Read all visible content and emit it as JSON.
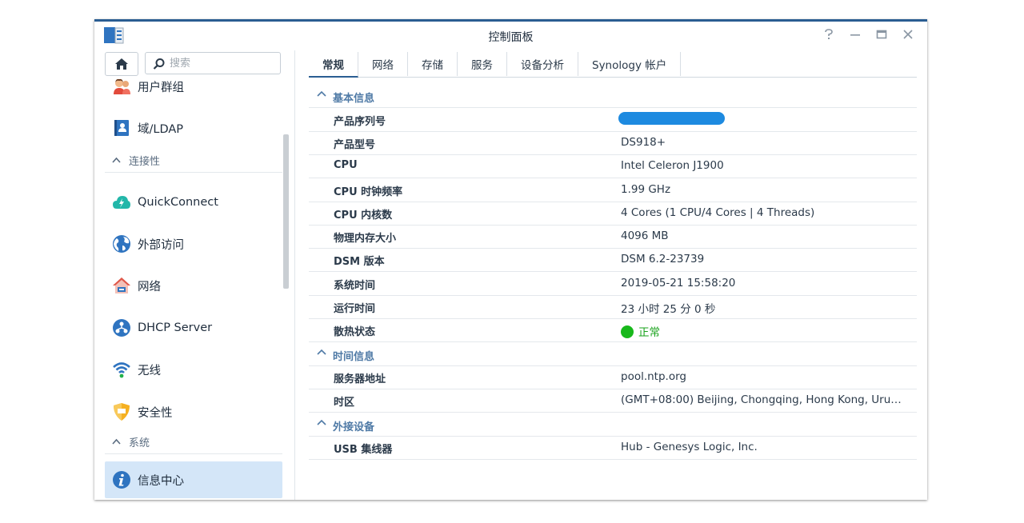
{
  "window": {
    "title": "控制面板"
  },
  "sidebar": {
    "search_placeholder": "搜索",
    "items": [
      {
        "label": "用户群组",
        "icon": "users-icon"
      },
      {
        "label": "域/LDAP",
        "icon": "ldap-icon"
      }
    ],
    "sections": [
      {
        "label": "连接性",
        "items": [
          {
            "label": "QuickConnect",
            "icon": "quickconnect-icon"
          },
          {
            "label": "外部访问",
            "icon": "globe-icon"
          },
          {
            "label": "网络",
            "icon": "house-network-icon"
          },
          {
            "label": "DHCP Server",
            "icon": "dhcp-icon"
          },
          {
            "label": "无线",
            "icon": "wifi-icon"
          },
          {
            "label": "安全性",
            "icon": "shield-icon"
          }
        ]
      },
      {
        "label": "系统",
        "items": [
          {
            "label": "信息中心",
            "icon": "info-icon",
            "active": true
          }
        ]
      }
    ]
  },
  "tabs": [
    "常规",
    "网络",
    "存储",
    "服务",
    "设备分析",
    "Synology 帐户"
  ],
  "groups": [
    {
      "title": "基本信息",
      "rows": [
        {
          "key": "产品序列号",
          "value": ""
        },
        {
          "key": "产品型号",
          "value": "DS918+"
        },
        {
          "key": "CPU",
          "value": "Intel Celeron J1900"
        },
        {
          "key": "CPU 时钟频率",
          "value": "1.99 GHz"
        },
        {
          "key": "CPU 内核数",
          "value": "4 Cores (1 CPU/4 Cores | 4 Threads)"
        },
        {
          "key": "物理内存大小",
          "value": "4096 MB"
        },
        {
          "key": "DSM 版本",
          "value": "DSM 6.2-23739"
        },
        {
          "key": "系统时间",
          "value": "2019-05-21 15:58:20"
        },
        {
          "key": "运行时间",
          "value": "23 小时 25 分 0 秒"
        },
        {
          "key": "散热状态",
          "value": "正常"
        }
      ]
    },
    {
      "title": "时间信息",
      "rows": [
        {
          "key": "服务器地址",
          "value": "pool.ntp.org"
        },
        {
          "key": "时区",
          "value": "(GMT+08:00) Beijing, Chongqing, Hong Kong, Uru…"
        }
      ]
    },
    {
      "title": "外接设备",
      "rows": [
        {
          "key": "USB 集线器",
          "value": "Hub - Genesys Logic, Inc."
        }
      ]
    }
  ],
  "colors": {
    "accent": "#2a5d92",
    "active_item": "#d4e6f8",
    "ok": "#18b81b",
    "group_title": "#4f7aa6"
  }
}
